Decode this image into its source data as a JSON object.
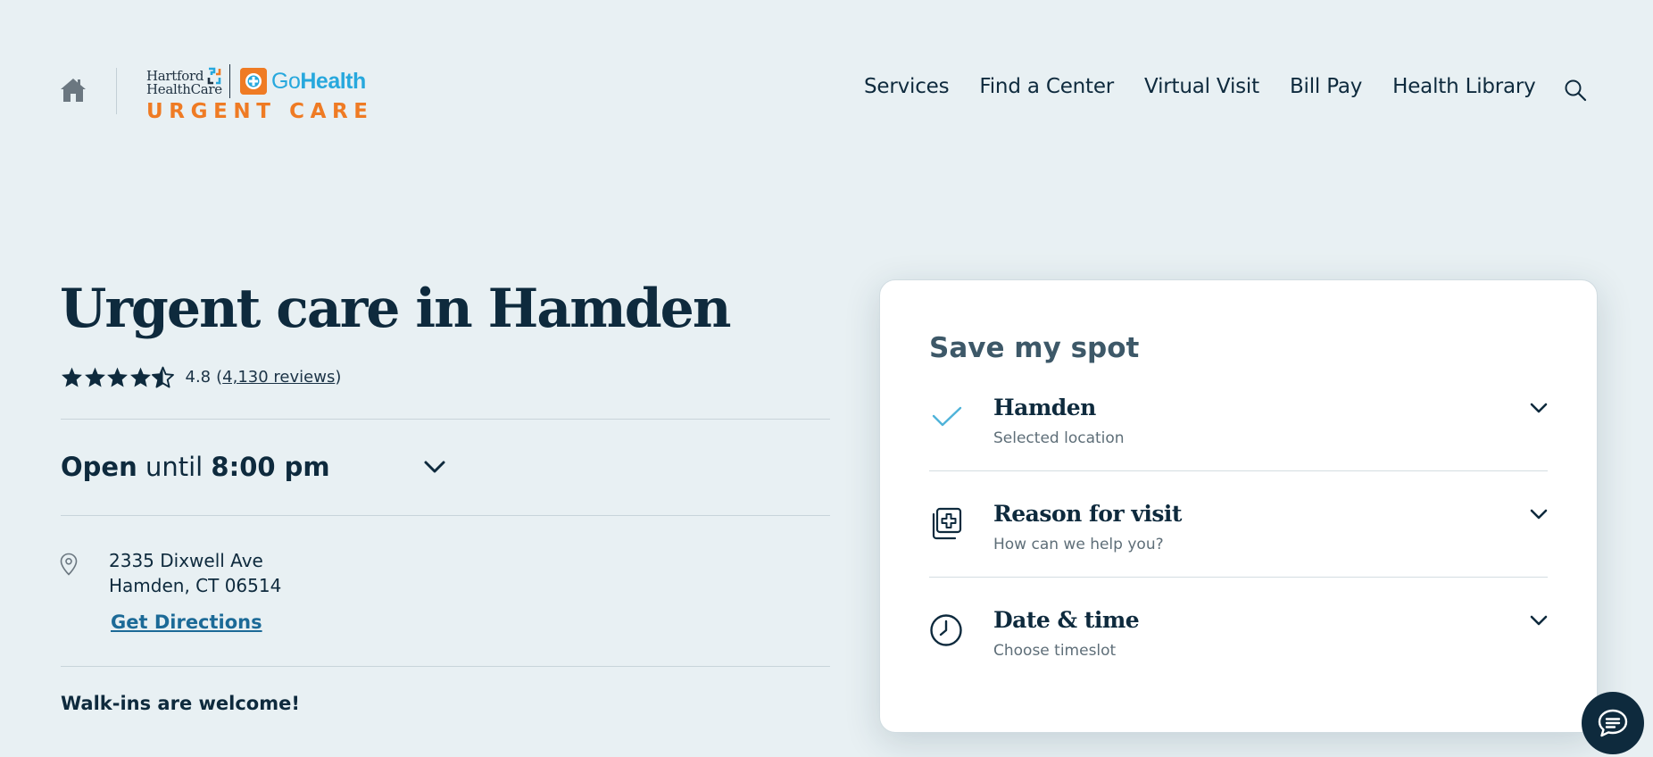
{
  "header": {
    "logo": {
      "hhc_line1": "Hartford",
      "hhc_line2": "HealthCare",
      "go_text_prefix": "Go",
      "go_text_suffix": "Health",
      "urgent_care": "URGENT CARE"
    },
    "nav_items": [
      "Services",
      "Find a Center",
      "Virtual Visit",
      "Bill Pay",
      "Health Library"
    ],
    "icons": {
      "home": "home-icon",
      "search": "search-icon"
    }
  },
  "location": {
    "title": "Urgent care in Hamden",
    "rating": {
      "stars": 4.8,
      "score": "4.8",
      "paren_open": "(",
      "reviews": "4,130 reviews",
      "paren_close": ")"
    },
    "hours": {
      "open": "Open",
      "until": "until",
      "time": "8:00 pm"
    },
    "address_line1": "2335 Dixwell Ave",
    "address_line2": "Hamden, CT 06514",
    "directions_label": "Get Directions",
    "walkins": "Walk-ins are welcome!"
  },
  "booking": {
    "title": "Save my spot",
    "steps": [
      {
        "title": "Hamden",
        "subtitle": "Selected location",
        "icon": "checkmark-icon"
      },
      {
        "title": "Reason for visit",
        "subtitle": "How can we help you?",
        "icon": "medical-cross-icon"
      },
      {
        "title": "Date & time",
        "subtitle": "Choose timeslot",
        "icon": "clock-icon"
      }
    ]
  },
  "colors": {
    "background": "#e8f0f3",
    "navy": "#0e2a3d",
    "orange": "#ef7b24",
    "blue": "#27a8dd",
    "link": "#1c6a97",
    "check": "#4fb3d9"
  }
}
